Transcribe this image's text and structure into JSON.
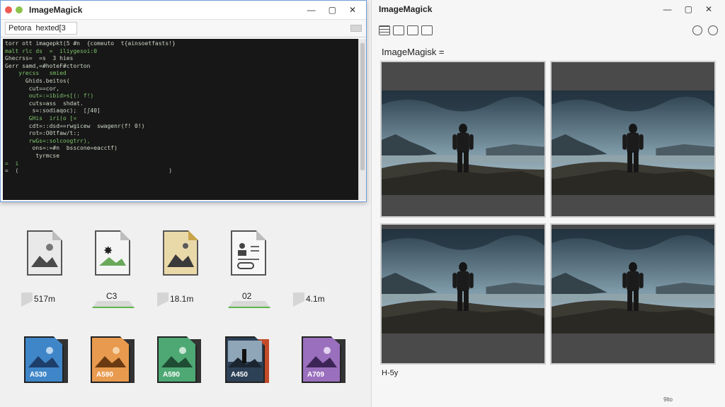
{
  "left_window": {
    "title": "ImageMagick",
    "controls": [
      "—",
      "▢",
      "✕"
    ],
    "address_value": "Petora  hexted[3",
    "terminal_lines": [
      "torr ott imagepkt(5 #n  {comeuto  t{ainsoetfasts!}",
      "malt rlc ds  =  iliygesoi:0",
      "Ghecrss=  =s  3 hies",
      "Gerr samd,=#hoteF#ctorton",
      "    yrecss   smied",
      "      Ghids.beitos(",
      "       cut==cor,",
      "       out=:=ibid>s[(: f!)",
      "       cuts=ass  shdat.",
      "        s=:sodiaqoc);  [ʃ40]",
      "       GHis  iri(o [=",
      "       cdt=::dsd==rwgicew  swagenr(f! 0!)",
      "       rot=:O0tfaw/t:;",
      "       rwGs=:solcoogtrr),",
      "        ons=:=#n  bsscone=eacctf)",
      "         tyrmcse",
      "=  i",
      "=  (                                            )"
    ]
  },
  "file_icons": [
    {
      "label": "517m",
      "name": "image-file-icon"
    },
    {
      "label": "C3",
      "name": "image-file-star-icon"
    },
    {
      "label": "18.1m",
      "name": "image-file-beige-icon"
    },
    {
      "label": "02",
      "name": "document-file-icon"
    },
    {
      "label": "4.1m",
      "name": "blank-file-icon"
    }
  ],
  "colored_icons": [
    {
      "label": "A530",
      "color": "#3f86c8",
      "name": "blue-image-file-icon"
    },
    {
      "label": "A590",
      "color": "#e89a4e",
      "name": "orange-image-file-icon"
    },
    {
      "label": "A590",
      "color": "#4ea874",
      "name": "green-image-file-icon"
    },
    {
      "label": "A450",
      "color": "#2d4156",
      "name": "photo-image-file-icon"
    },
    {
      "label": "A709",
      "color": "#9a6fbd",
      "name": "purple-image-file-icon"
    }
  ],
  "right_window": {
    "title": "ImageMagick",
    "controls": [
      "—",
      "▢",
      "✕"
    ],
    "section_label": "ImageMagisk =",
    "footer_label": "H-5y",
    "corner_text": "9lto"
  }
}
